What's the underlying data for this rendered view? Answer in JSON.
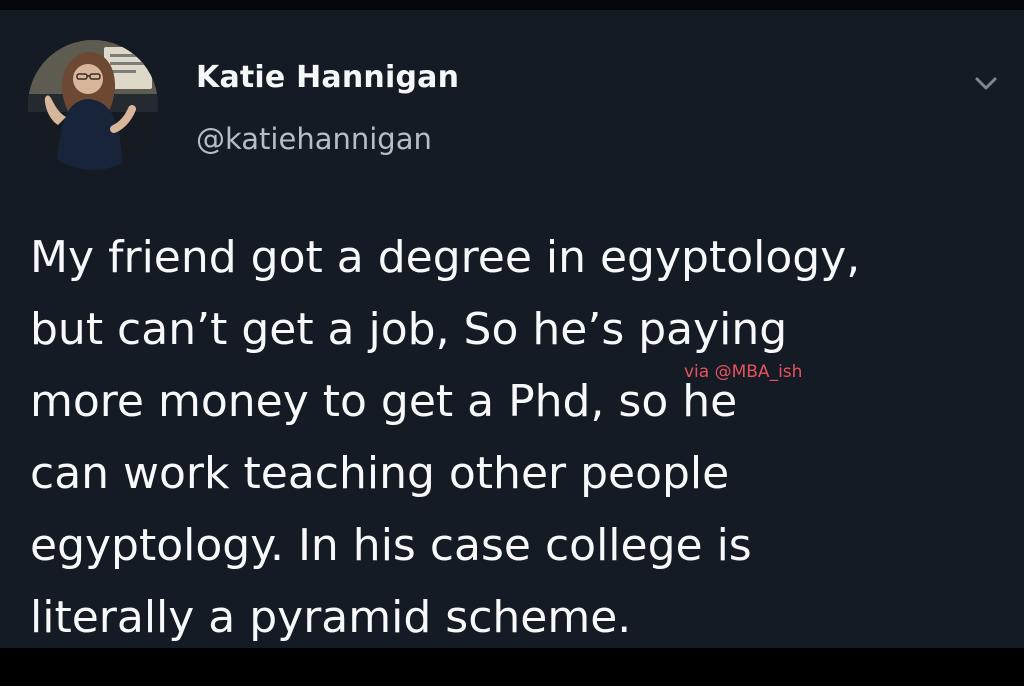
{
  "tweet": {
    "author_name": "Katie Hannigan",
    "handle": "@katiehannigan",
    "text_lines": [
      "My friend got a degree in egyptology,",
      "but can’t get a job, So he’s paying",
      "more money to get a Phd, so he",
      "can work teaching other people",
      "egyptology.  In his case college is",
      "literally a pyramid scheme."
    ],
    "watermark": "via @MBA_ish"
  },
  "icons": {
    "menu": "chevron-down-icon"
  },
  "colors": {
    "card_background": "#151b24",
    "primary_text": "#f7f8fa",
    "secondary_text": "#b5bec7",
    "watermark": "#e7525c"
  }
}
